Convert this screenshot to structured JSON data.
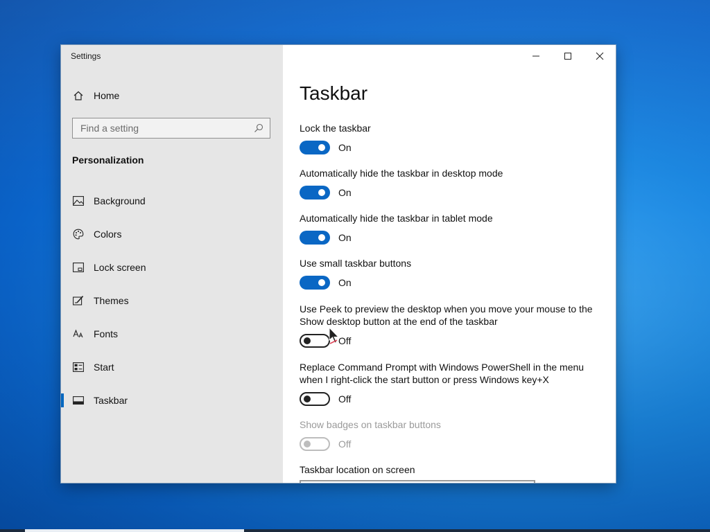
{
  "window": {
    "title": "Settings"
  },
  "sidebar": {
    "home_label": "Home",
    "search_placeholder": "Find a setting",
    "section_label": "Personalization",
    "items": [
      {
        "label": "Background",
        "icon": "picture-icon"
      },
      {
        "label": "Colors",
        "icon": "palette-icon"
      },
      {
        "label": "Lock screen",
        "icon": "lock-screen-icon"
      },
      {
        "label": "Themes",
        "icon": "themes-icon"
      },
      {
        "label": "Fonts",
        "icon": "fonts-icon"
      },
      {
        "label": "Start",
        "icon": "start-icon"
      },
      {
        "label": "Taskbar",
        "icon": "taskbar-icon",
        "selected": true
      }
    ]
  },
  "main": {
    "title": "Taskbar",
    "settings": [
      {
        "label": "Lock the taskbar",
        "state": "On"
      },
      {
        "label": "Automatically hide the taskbar in desktop mode",
        "state": "On"
      },
      {
        "label": "Automatically hide the taskbar in tablet mode",
        "state": "On"
      },
      {
        "label": "Use small taskbar buttons",
        "state": "On"
      },
      {
        "label": "Use Peek to preview the desktop when you move your mouse to the Show desktop button at the end of the taskbar",
        "state": "Off"
      },
      {
        "label": "Replace Command Prompt with Windows PowerShell in the menu when I right-click the start button or press Windows key+X",
        "state": "Off"
      },
      {
        "label": "Show badges on taskbar buttons",
        "state": "Off",
        "disabled": true
      }
    ],
    "location_label": "Taskbar location on screen"
  },
  "colors": {
    "accent": "#0a67c4",
    "sidebar_bg": "#e6e6e6",
    "disabled_text": "#9a9a9a"
  }
}
